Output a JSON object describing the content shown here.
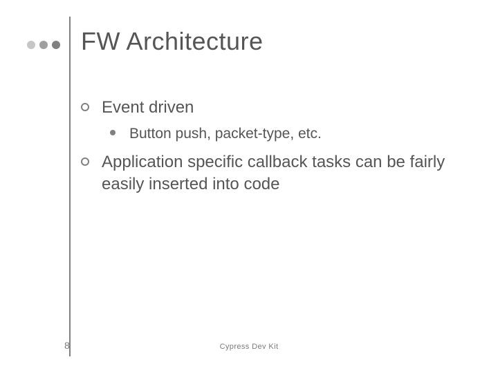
{
  "slide": {
    "title": "FW Architecture",
    "bullets": [
      {
        "text": "Event driven",
        "children": [
          {
            "text": "Button push, packet-type, etc."
          }
        ]
      },
      {
        "text": "Application specific callback tasks can be fairly easily inserted into code",
        "children": []
      }
    ],
    "page_number": "8",
    "footer": "Cypress Dev Kit"
  }
}
